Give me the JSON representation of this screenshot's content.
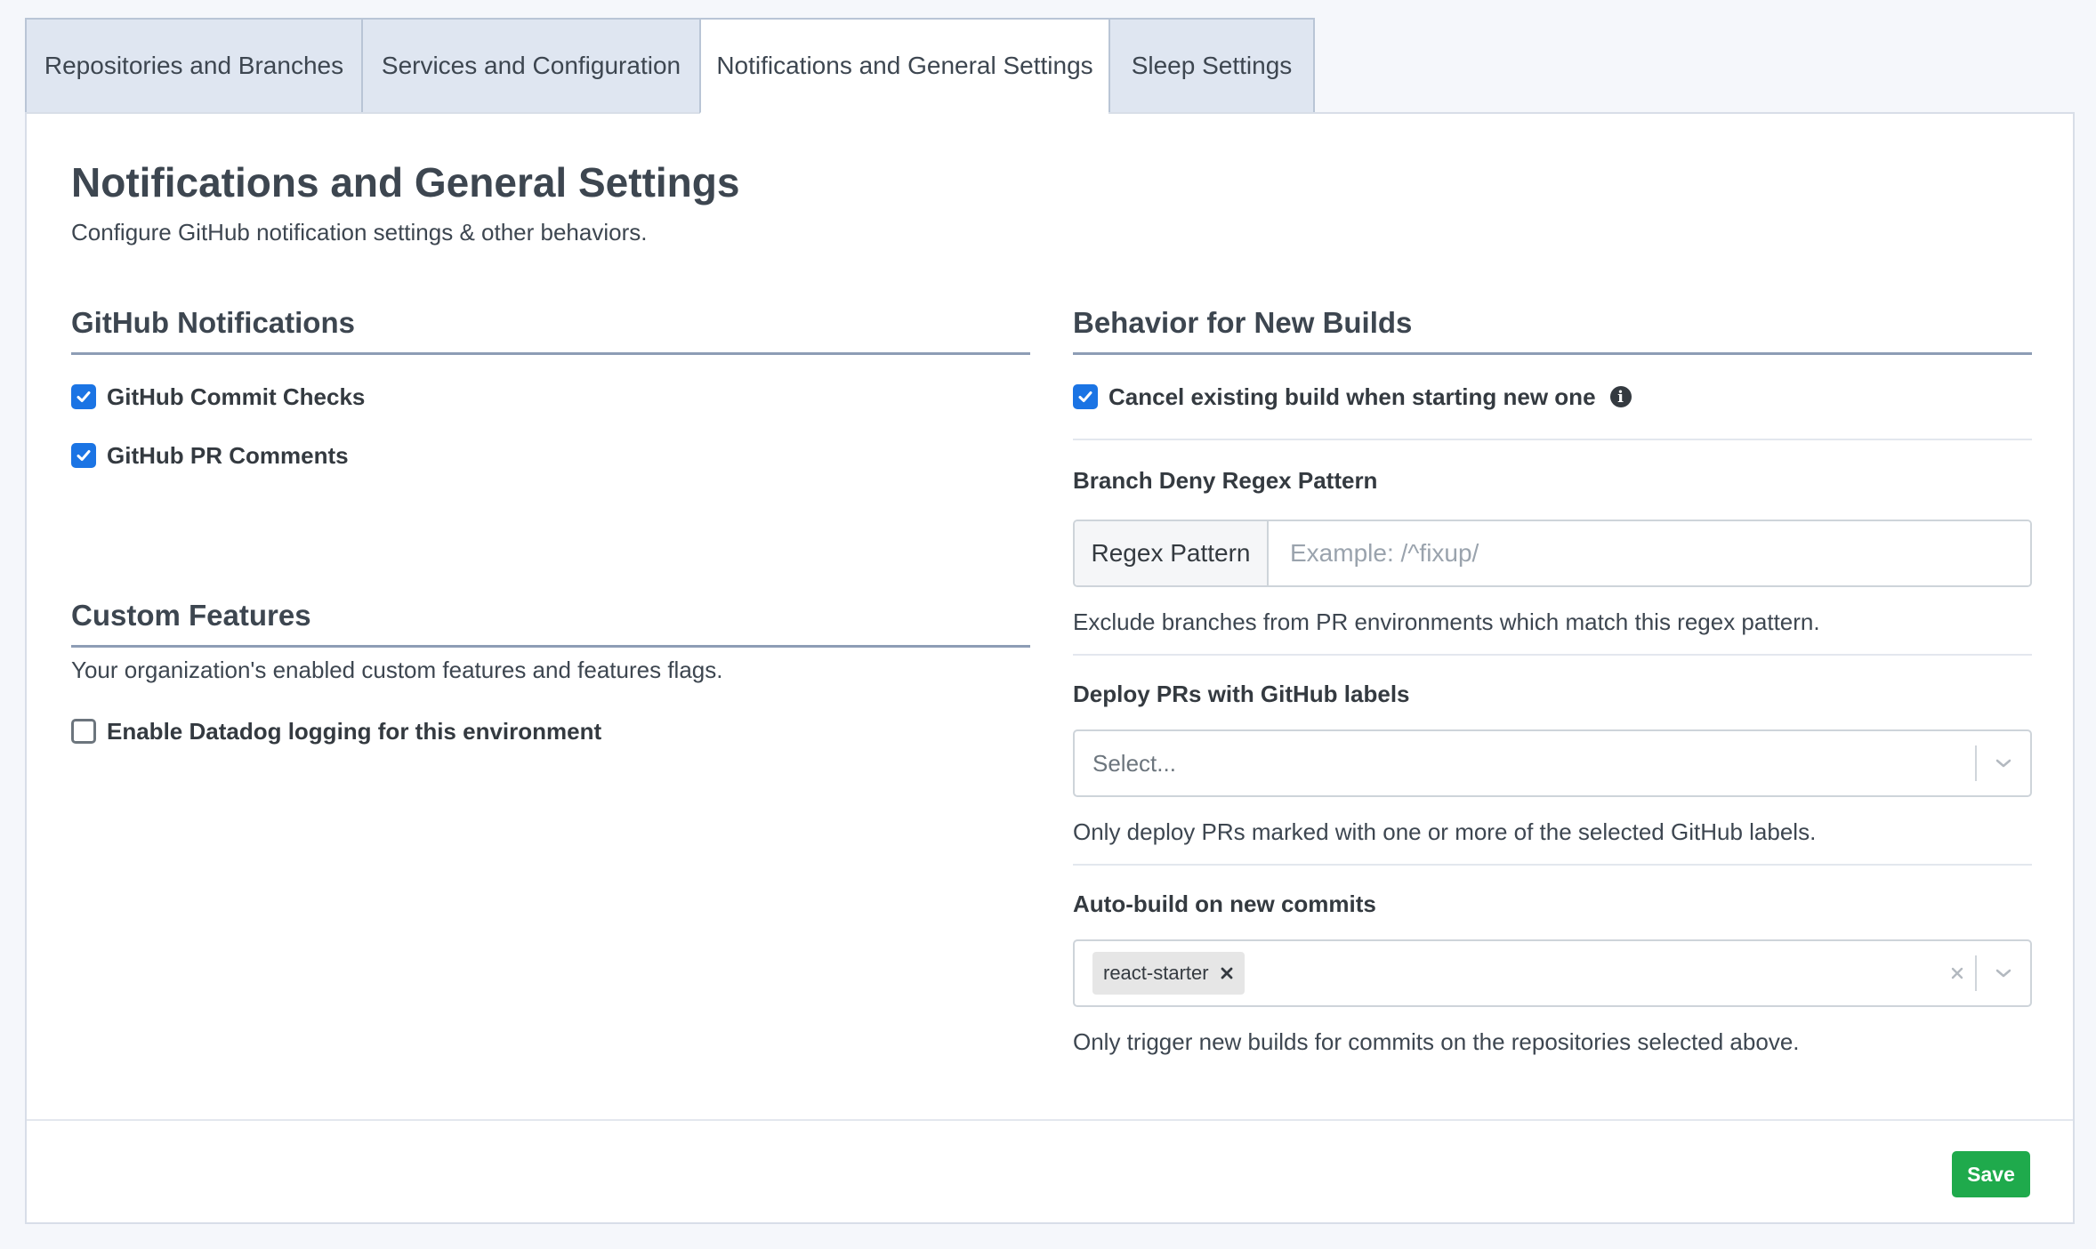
{
  "tabs": [
    {
      "label": "Repositories and Branches"
    },
    {
      "label": "Services and Configuration"
    },
    {
      "label": "Notifications and General Settings"
    },
    {
      "label": "Sleep Settings"
    }
  ],
  "page": {
    "title": "Notifications and General Settings",
    "subtitle": "Configure GitHub notification settings & other behaviors."
  },
  "github_notifications": {
    "heading": "GitHub Notifications",
    "options": [
      {
        "label": "GitHub Commit Checks",
        "checked": true
      },
      {
        "label": "GitHub PR Comments",
        "checked": true
      }
    ]
  },
  "custom_features": {
    "heading": "Custom Features",
    "description": "Your organization's enabled custom features and features flags.",
    "options": [
      {
        "label": "Enable Datadog logging for this environment",
        "checked": false
      }
    ]
  },
  "new_builds": {
    "heading": "Behavior for New Builds",
    "cancel_existing": {
      "label": "Cancel existing build when starting new one",
      "checked": true
    },
    "branch_deny": {
      "label": "Branch Deny Regex Pattern",
      "prefix": "Regex Pattern",
      "placeholder": "Example: /^fixup/",
      "value": "",
      "help": "Exclude branches from PR environments which match this regex pattern."
    },
    "deploy_labels": {
      "label": "Deploy PRs with GitHub labels",
      "placeholder": "Select...",
      "help": "Only deploy PRs marked with one or more of the selected GitHub labels."
    },
    "auto_build": {
      "label": "Auto-build on new commits",
      "tags": [
        "react-starter"
      ],
      "help": "Only trigger new builds for commits on the repositories selected above."
    }
  },
  "footer": {
    "save_label": "Save"
  },
  "colors": {
    "accent": "#1b74e4",
    "save": "#1faa4c",
    "tab_inactive": "#dfe6f1"
  }
}
